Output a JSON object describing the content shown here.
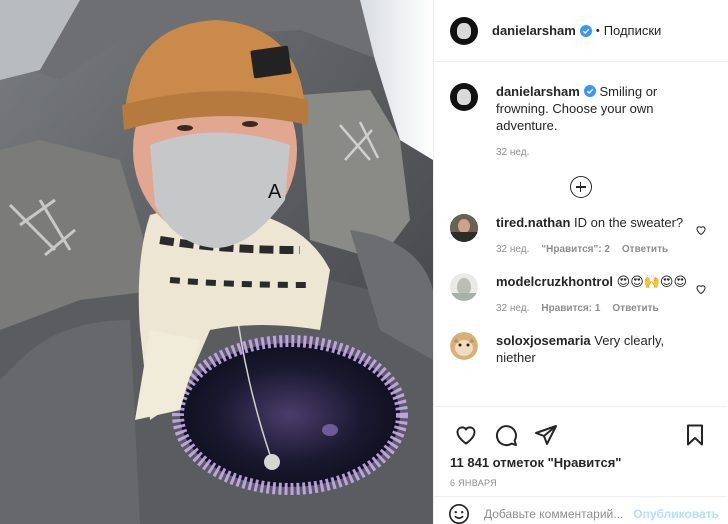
{
  "post": {
    "username": "danielarsham",
    "follow_label": "Подписки",
    "dot": "•",
    "caption": "Smiling or frowning. Choose your own adventure.",
    "caption_time": "32 нед.",
    "photo_mask_letter": "A"
  },
  "comments": [
    {
      "user": "tired.nathan",
      "text": "ID on the sweater?",
      "time": "32 нед.",
      "likes": "\"Нравится\": 2",
      "reply": "Ответить"
    },
    {
      "user": "modelcruzkhontrol",
      "text": "😍😍🙌😍😍",
      "time": "32 нед.",
      "likes": "Нравится: 1",
      "reply": "Ответить"
    },
    {
      "user": "soloxjosemaria",
      "text": "Very clearly, niether"
    }
  ],
  "stats": {
    "likes_text": "11 841 отметок \"Нравится\"",
    "date": "6 января"
  },
  "add_comment": {
    "placeholder": "Добавьте комментарий...",
    "post_label": "Опубликовать"
  },
  "colors": {
    "accent_blue": "#0095f6",
    "post_disabled": "#b2dffc",
    "muted": "#8e8e8e",
    "text": "#262626",
    "beanie": "#c98a4a"
  },
  "icons": [
    "verified-badge-icon",
    "plus-circle-icon",
    "heart-icon",
    "comment-icon",
    "share-icon",
    "bookmark-icon",
    "emoji-icon"
  ]
}
